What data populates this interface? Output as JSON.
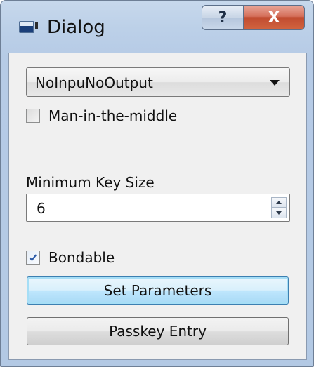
{
  "window": {
    "title": "Dialog",
    "help_glyph": "?",
    "close_glyph": "X"
  },
  "io_capability": {
    "selected": "NoInpuNoOutput"
  },
  "mitm": {
    "label": "Man-in-the-middle",
    "checked": false
  },
  "min_key_size": {
    "label": "Minimum Key Size",
    "value": "6"
  },
  "bondable": {
    "label": "Bondable",
    "checked": true
  },
  "buttons": {
    "set_parameters": "Set Parameters",
    "passkey_entry": "Passkey Entry"
  },
  "colors": {
    "titlebar": "#bcd0e8",
    "close_button": "#c84c31",
    "default_button": "#bee6fd",
    "client_background": "#f0f0f0"
  }
}
